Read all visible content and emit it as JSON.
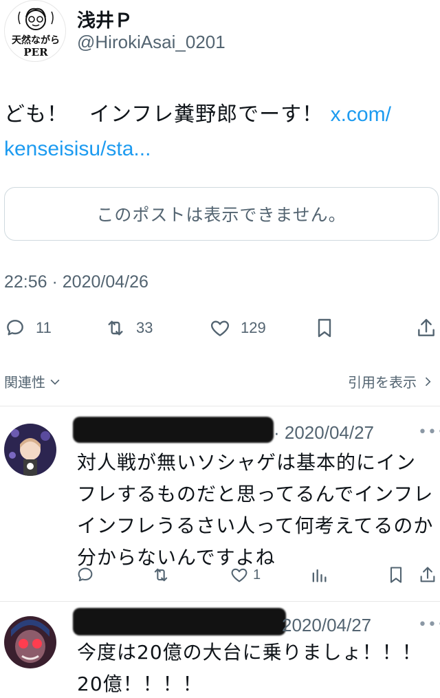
{
  "author": {
    "name": "浅井Ｐ",
    "handle": "@HirokiAsai_0201",
    "avatar_caption": "天然ながら PER"
  },
  "tweet": {
    "text": "ども！　インフレ糞野郎でーす！",
    "link_line1": "x.com/",
    "link_line2": "kenseisisu/sta...",
    "quoted_unavailable": "このポストは表示できません。",
    "timestamp": "22:56 · 2020/04/26"
  },
  "actions": {
    "replies": "11",
    "retweets": "33",
    "likes": "129"
  },
  "related": {
    "label": "関連性",
    "view_quotes": "引用を表示"
  },
  "replies": [
    {
      "date": "· 2020/04/27",
      "text": "対人戦が無いソシャゲは基本的にインフレするものだと思ってるんでインフレインフレうるさい人って何考えてるのか分からないんですよね",
      "likes": "1"
    },
    {
      "date": "2020/04/27",
      "text": "今度は20億の大台に乗りましょ！！！20億！！！！"
    }
  ],
  "colors": {
    "link": "#1d9bf0",
    "muted": "#536471",
    "border": "#cfd9de"
  },
  "icons": [
    "reply-icon",
    "retweet-icon",
    "like-icon",
    "bookmark-icon",
    "share-icon",
    "views-icon",
    "chevron-down-icon",
    "chevron-right-icon",
    "more-icon"
  ]
}
